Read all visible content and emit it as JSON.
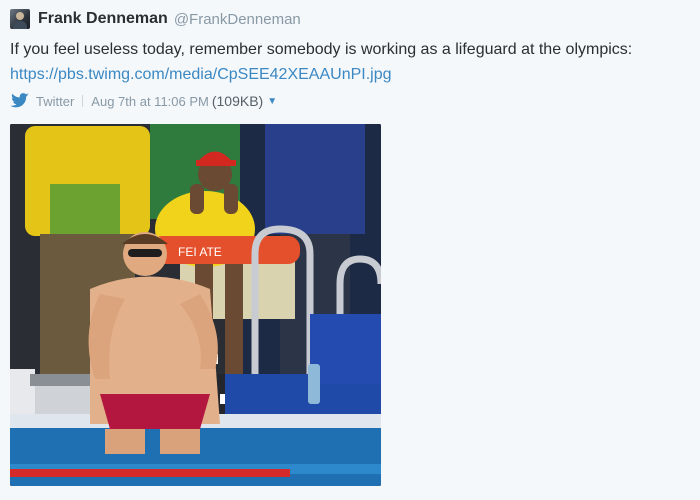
{
  "tweet": {
    "author_name": "Frank Denneman",
    "author_handle": "@FrankDenneman",
    "text": "If you feel useless today, remember somebody is working as a lifeguard at the olympics:",
    "link": "https://pbs.twimg.com/media/CpSEE42XEAAUnPI.jpg",
    "source": "Twitter",
    "timestamp": "Aug 7th at 11:06 PM",
    "media_size": "(109KB)",
    "buoy_text": "FEI  ATE"
  },
  "icons": {
    "avatar": "avatar-icon",
    "bird": "twitter-bird-icon",
    "caret": "caret-down-icon"
  },
  "colors": {
    "link": "#3b88c3",
    "pool": "#1f6fb3",
    "lifeguard_shirt": "#f2d31b",
    "buoy": "#e4502b"
  }
}
